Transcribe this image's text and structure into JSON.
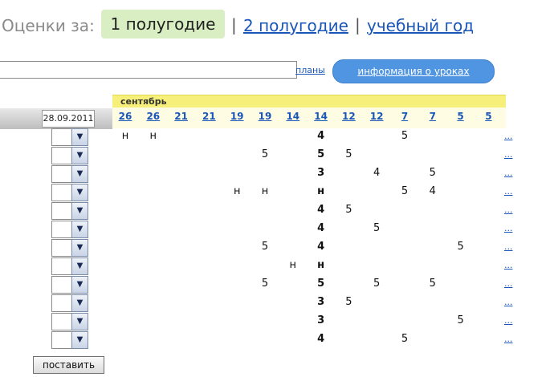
{
  "period": {
    "label": "Оценки за:",
    "active": "1 полугодие",
    "sep": "|",
    "links": [
      "2 полугодие",
      "учебный год"
    ]
  },
  "toolbar": {
    "search_value": "",
    "plans_link": "планы",
    "info_button": "информация о уроках"
  },
  "journal": {
    "date_value": "28.09.2011",
    "month": "сентябрь",
    "dates": [
      {
        "label": "26",
        "marked": false
      },
      {
        "label": "26",
        "marked": false
      },
      {
        "label": "21",
        "marked": false
      },
      {
        "label": "21",
        "marked": false
      },
      {
        "label": "19",
        "marked": true
      },
      {
        "label": "19",
        "marked": false
      },
      {
        "label": "14",
        "marked": false
      },
      {
        "label": "14",
        "marked": false
      },
      {
        "label": "12",
        "marked": true
      },
      {
        "label": "12",
        "marked": false
      },
      {
        "label": "7",
        "marked": true
      },
      {
        "label": "7",
        "marked": false
      },
      {
        "label": "5",
        "marked": true
      },
      {
        "label": "5",
        "marked": false
      }
    ],
    "rows": [
      [
        "н",
        "н",
        "",
        "",
        "",
        "",
        "",
        "4",
        "",
        "",
        "5",
        "",
        "",
        ""
      ],
      [
        "",
        "",
        "",
        "",
        "",
        "5",
        "",
        "5",
        "5",
        "",
        "",
        "",
        "",
        ""
      ],
      [
        "",
        "",
        "",
        "",
        "",
        "",
        "",
        "3",
        "",
        "4",
        "",
        "5",
        "",
        ""
      ],
      [
        "",
        "",
        "",
        "",
        "н",
        "н",
        "",
        "н",
        "",
        "",
        "5",
        "4",
        "",
        ""
      ],
      [
        "",
        "",
        "",
        "",
        "",
        "",
        "",
        "4",
        "5",
        "",
        "",
        "",
        "",
        ""
      ],
      [
        "",
        "",
        "",
        "",
        "",
        "",
        "",
        "4",
        "",
        "5",
        "",
        "",
        "",
        ""
      ],
      [
        "",
        "",
        "",
        "",
        "",
        "5",
        "",
        "4",
        "",
        "",
        "",
        "",
        "5",
        ""
      ],
      [
        "",
        "",
        "",
        "",
        "",
        "",
        "н",
        "н",
        "",
        "",
        "",
        "",
        "",
        ""
      ],
      [
        "",
        "",
        "",
        "",
        "",
        "5",
        "",
        "5",
        "",
        "5",
        "",
        "5",
        "",
        ""
      ],
      [
        "",
        "",
        "",
        "",
        "",
        "",
        "",
        "3",
        "5",
        "",
        "",
        "",
        "",
        ""
      ],
      [
        "",
        "",
        "",
        "",
        "",
        "",
        "",
        "3",
        "",
        "",
        "",
        "",
        "5",
        ""
      ],
      [
        "",
        "",
        "",
        "",
        "",
        "",
        "",
        "4",
        "",
        "",
        "5",
        "",
        "",
        ""
      ]
    ],
    "more_link": "...",
    "select_arrow": "▼"
  },
  "submit_label": "поставить"
}
